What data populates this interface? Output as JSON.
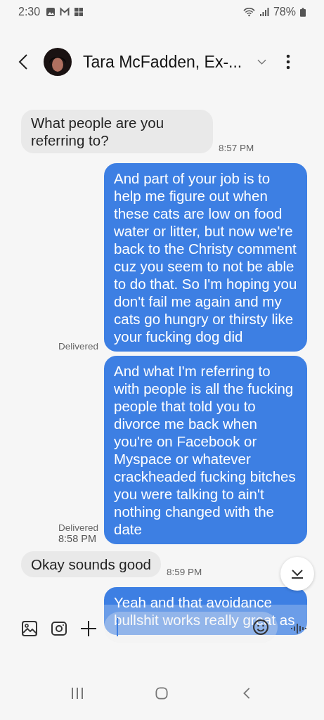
{
  "status_bar": {
    "time": "2:30",
    "battery": "78%"
  },
  "header": {
    "contact_name": "Tara McFadden, Ex-..."
  },
  "messages": [
    {
      "kind": "incoming",
      "text": "What people are you referring to?",
      "time": "8:57 PM"
    },
    {
      "kind": "outgoing",
      "text": " And part of your job is to help me figure out when these cats are low on food water or litter, but now we're back to the Christy comment cuz you seem to not be able to do that. So I'm hoping you don't fail me again and my cats go hungry or thirsty like your fucking dog did",
      "status": "Delivered"
    },
    {
      "kind": "outgoing",
      "text": "And what I'm referring to with people is all the fucking people that told you to divorce me back when you're on Facebook or Myspace or whatever crackheaded fucking bitches you were talking to ain't nothing changed with the date",
      "status": "Delivered",
      "time": "8:58 PM"
    },
    {
      "kind": "incoming",
      "text": "Okay sounds good",
      "time": "8:59 PM"
    },
    {
      "kind": "outgoing",
      "text": "Yeah and that avoidance bullshit works really great as"
    }
  ]
}
